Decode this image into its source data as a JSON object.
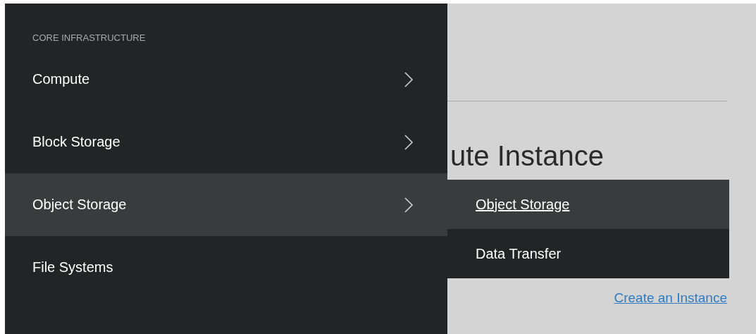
{
  "sidebar": {
    "section_title": "CORE INFRASTRUCTURE",
    "items": [
      {
        "label": "Compute",
        "has_submenu": true,
        "selected": false
      },
      {
        "label": "Block Storage",
        "has_submenu": true,
        "selected": false
      },
      {
        "label": "Object Storage",
        "has_submenu": true,
        "selected": true
      },
      {
        "label": "File Systems",
        "has_submenu": false,
        "selected": false
      }
    ]
  },
  "submenu": {
    "items": [
      {
        "label": "Object Storage",
        "selected": true
      },
      {
        "label": "Data Transfer",
        "selected": false
      }
    ]
  },
  "main": {
    "heading": "ute Instance",
    "link": "Create an Instance"
  }
}
